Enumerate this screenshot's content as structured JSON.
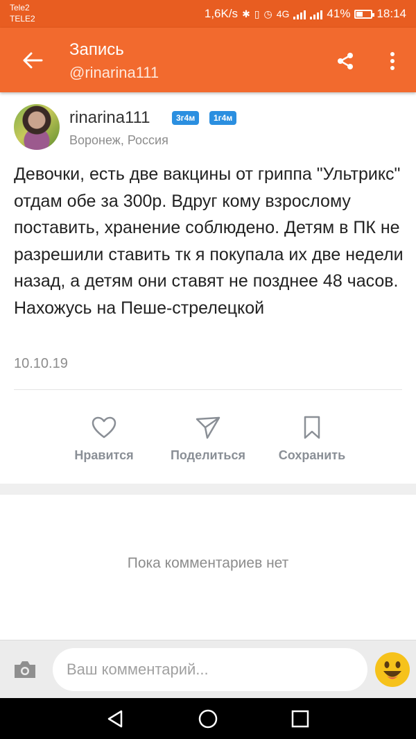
{
  "status_bar": {
    "carrier_1": "Tele2",
    "carrier_2": "TELE2",
    "network_speed": "1,6K/s",
    "network_type": "4G",
    "battery_percent": "41%",
    "battery_level": 0.41,
    "time": "18:14"
  },
  "app_bar": {
    "title": "Запись",
    "subtitle": "@rinarina111",
    "icons": [
      "back-arrow-icon",
      "share-icon",
      "more-vert-icon"
    ]
  },
  "post": {
    "author": "rinarina111",
    "badges": [
      "3г4м",
      "1г4м"
    ],
    "location": "Воронеж, Россия",
    "text": "Девочки, есть две вакцины от гриппа \"Ультрикс\" отдам обе за 300р. Вдруг кому взрослому поставить, хранение соблюдено. Детям в ПК не разрешили ставить тк я покупала их две недели назад, а детям они ставят не позднее 48 часов. Нахожусь на Пеше-стрелецкой",
    "date": "10.10.19"
  },
  "actions": {
    "like_label": "Нравится",
    "share_label": "Поделиться",
    "save_label": "Сохранить"
  },
  "comments": {
    "empty_text": "Пока комментариев нет"
  },
  "comment_bar": {
    "placeholder": "Ваш комментарий..."
  },
  "colors": {
    "status_bar": "#e85d21",
    "app_bar": "#f26a2e",
    "badge": "#2b8fe0",
    "action_gray": "#8a8f96"
  }
}
